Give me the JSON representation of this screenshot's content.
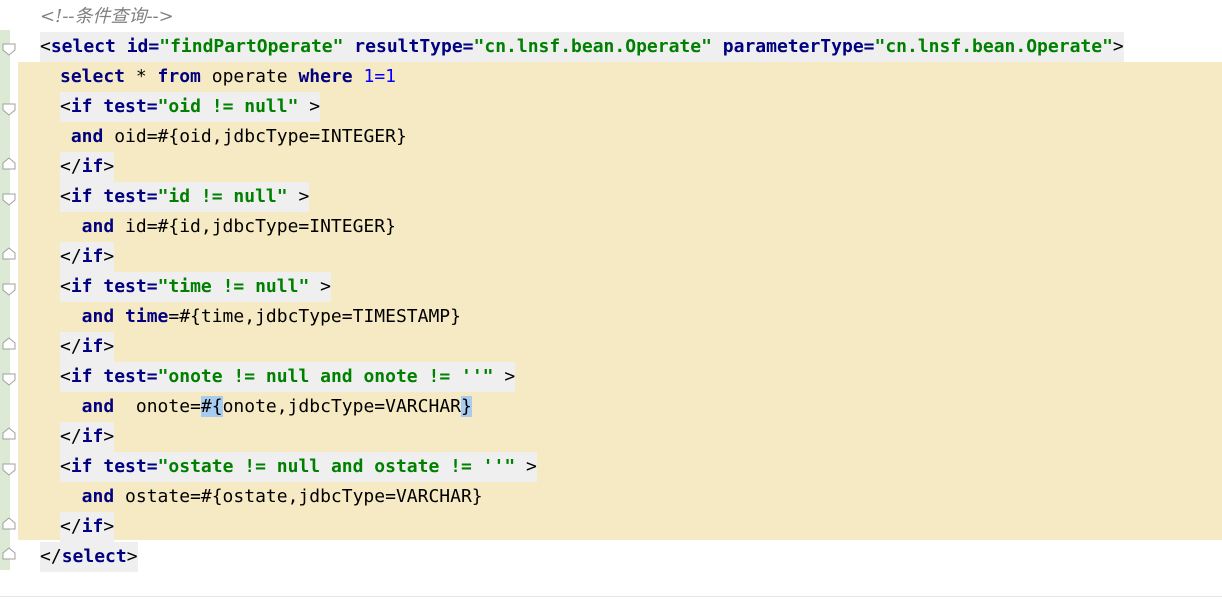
{
  "editor": {
    "comment": "<!--条件查询-->",
    "lines": [
      {
        "parts": [
          {
            "t": "<",
            "c": "plain"
          },
          {
            "t": "select",
            "c": "kw"
          },
          {
            "t": " id=",
            "c": "kw"
          },
          {
            "t": "\"findPartOperate\"",
            "c": "str"
          },
          {
            "t": " resultType=",
            "c": "kw"
          },
          {
            "t": "\"cn.lnsf.bean.Operate\"",
            "c": "str"
          },
          {
            "t": " parameterType=",
            "c": "kw"
          },
          {
            "t": "\"cn.lnsf.bean.Operate\"",
            "c": "str"
          },
          {
            "t": ">",
            "c": "plain"
          }
        ]
      },
      {
        "parts": [
          {
            "t": "select",
            "c": "kw"
          },
          {
            "t": " * ",
            "c": "plain"
          },
          {
            "t": "from",
            "c": "kw"
          },
          {
            "t": " operate ",
            "c": "plain"
          },
          {
            "t": "where",
            "c": "kw"
          },
          {
            "t": " 1=1",
            "c": "num"
          }
        ]
      },
      {
        "parts": [
          {
            "t": "<",
            "c": "plain"
          },
          {
            "t": "if",
            "c": "kw"
          },
          {
            "t": " test=",
            "c": "kw"
          },
          {
            "t": "\"oid != null\"",
            "c": "str"
          },
          {
            "t": " >",
            "c": "plain"
          }
        ]
      },
      {
        "parts": [
          {
            "t": " and",
            "c": "kw"
          },
          {
            "t": " oid=#{oid,jdbcType=INTEGER}",
            "c": "plain"
          }
        ]
      },
      {
        "parts": [
          {
            "t": "</",
            "c": "plain"
          },
          {
            "t": "if",
            "c": "kw"
          },
          {
            "t": ">",
            "c": "plain"
          }
        ]
      },
      {
        "parts": [
          {
            "t": "<",
            "c": "plain"
          },
          {
            "t": "if",
            "c": "kw"
          },
          {
            "t": " test=",
            "c": "kw"
          },
          {
            "t": "\"id != null\"",
            "c": "str"
          },
          {
            "t": " >",
            "c": "plain"
          }
        ]
      },
      {
        "parts": [
          {
            "t": "  and",
            "c": "kw"
          },
          {
            "t": " id=#{id,jdbcType=INTEGER}",
            "c": "plain"
          }
        ]
      },
      {
        "parts": [
          {
            "t": "</",
            "c": "plain"
          },
          {
            "t": "if",
            "c": "kw"
          },
          {
            "t": ">",
            "c": "plain"
          }
        ]
      },
      {
        "parts": [
          {
            "t": "<",
            "c": "plain"
          },
          {
            "t": "if",
            "c": "kw"
          },
          {
            "t": " test=",
            "c": "kw"
          },
          {
            "t": "\"time != null\"",
            "c": "str"
          },
          {
            "t": " >",
            "c": "plain"
          }
        ]
      },
      {
        "parts": [
          {
            "t": "  and",
            "c": "kw"
          },
          {
            "t": " time",
            "c": "kw"
          },
          {
            "t": "=#{time,jdbcType=TIMESTAMP}",
            "c": "plain"
          }
        ]
      },
      {
        "parts": [
          {
            "t": "</",
            "c": "plain"
          },
          {
            "t": "if",
            "c": "kw"
          },
          {
            "t": ">",
            "c": "plain"
          }
        ]
      },
      {
        "parts": [
          {
            "t": "<",
            "c": "plain"
          },
          {
            "t": "if",
            "c": "kw"
          },
          {
            "t": " test=",
            "c": "kw"
          },
          {
            "t": "\"onote != null and onote != ''\"",
            "c": "str"
          },
          {
            "t": " >",
            "c": "plain"
          }
        ]
      },
      {
        "parts": [
          {
            "t": "  and",
            "c": "kw"
          },
          {
            "t": "  onote=",
            "c": "plain"
          },
          {
            "t": "#{",
            "c": "plain",
            "hl": true
          },
          {
            "t": "onote,jdbcType=VARCHAR",
            "c": "plain"
          },
          {
            "t": "}",
            "c": "plain",
            "hl": true
          }
        ]
      },
      {
        "parts": [
          {
            "t": "</",
            "c": "plain"
          },
          {
            "t": "if",
            "c": "kw"
          },
          {
            "t": ">",
            "c": "plain"
          }
        ]
      },
      {
        "parts": [
          {
            "t": "<",
            "c": "plain"
          },
          {
            "t": "if",
            "c": "kw"
          },
          {
            "t": " test=",
            "c": "kw"
          },
          {
            "t": "\"ostate != null and ostate != ''\"",
            "c": "str"
          },
          {
            "t": " >",
            "c": "plain"
          }
        ]
      },
      {
        "parts": [
          {
            "t": "  and",
            "c": "kw"
          },
          {
            "t": " ostate=#{ostate,jdbcType=VARCHAR}",
            "c": "plain"
          }
        ]
      },
      {
        "parts": [
          {
            "t": "</",
            "c": "plain"
          },
          {
            "t": "if",
            "c": "kw"
          },
          {
            "t": ">",
            "c": "plain"
          }
        ]
      },
      {
        "parts": [
          {
            "t": "</",
            "c": "plain"
          },
          {
            "t": "select",
            "c": "kw"
          },
          {
            "t": ">",
            "c": "plain"
          }
        ]
      }
    ]
  }
}
